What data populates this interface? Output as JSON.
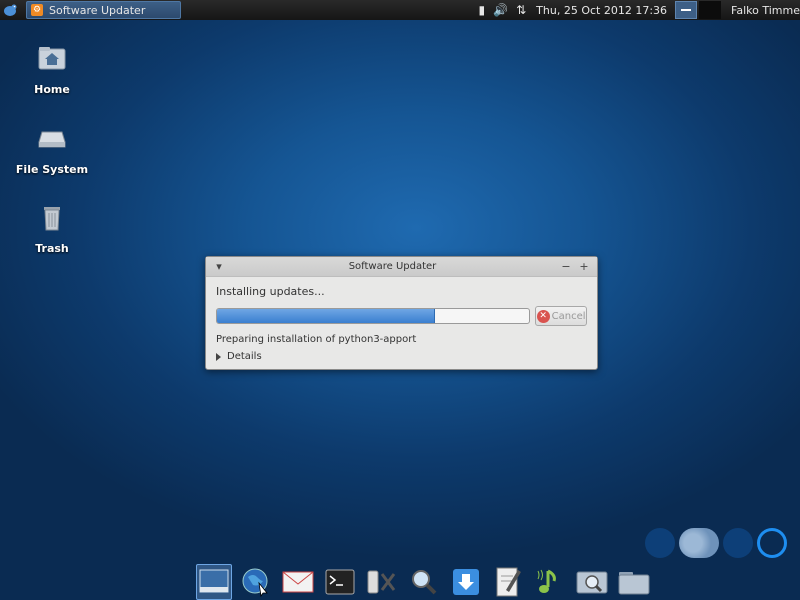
{
  "top_panel": {
    "window_button": "Software Updater",
    "clock": "Thu, 25 Oct 2012 17:36",
    "user": "Falko Timme"
  },
  "desktop_icons": [
    {
      "label": "Home",
      "icon": "home-folder-icon"
    },
    {
      "label": "File System",
      "icon": "drive-icon"
    },
    {
      "label": "Trash",
      "icon": "trash-icon"
    }
  ],
  "dialog": {
    "title": "Software Updater",
    "heading": "Installing updates...",
    "progress_fraction": 0.7,
    "cancel_label": "Cancel",
    "status": "Preparing installation of python3-apport",
    "details_label": "Details"
  },
  "dock_items": [
    "desktop-icon",
    "web-browser-icon",
    "mail-icon",
    "terminal-icon",
    "settings-icon",
    "search-icon",
    "download-icon",
    "text-editor-icon",
    "music-player-icon",
    "image-viewer-icon",
    "file-manager-icon"
  ],
  "colors": {
    "accent": "#3a7fd0",
    "panel": "#1e1e1e",
    "desktop": "#155593"
  }
}
